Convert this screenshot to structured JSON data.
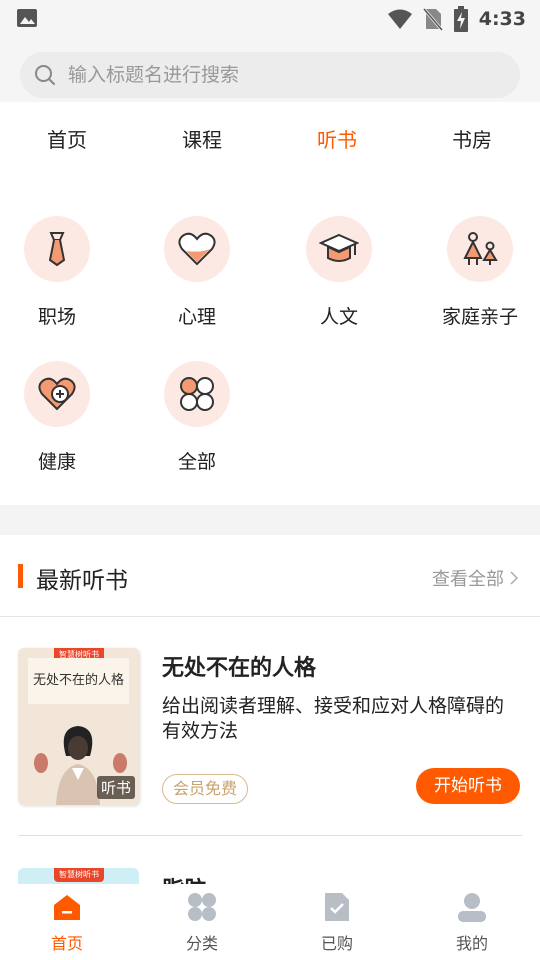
{
  "status_bar": {
    "time": "4:33"
  },
  "search": {
    "placeholder": "输入标题名进行搜索"
  },
  "tabs": [
    {
      "label": "首页",
      "active": false
    },
    {
      "label": "课程",
      "active": false
    },
    {
      "label": "听书",
      "active": true
    },
    {
      "label": "书房",
      "active": false
    }
  ],
  "categories": [
    {
      "label": "职场",
      "icon": "tie-icon"
    },
    {
      "label": "心理",
      "icon": "heart-icon"
    },
    {
      "label": "人文",
      "icon": "graduation-cap-icon"
    },
    {
      "label": "家庭亲子",
      "icon": "family-icon"
    },
    {
      "label": "健康",
      "icon": "health-heart-icon"
    },
    {
      "label": "全部",
      "icon": "grid-icon"
    }
  ],
  "section": {
    "title": "最新听书",
    "more": "查看全部"
  },
  "books": [
    {
      "cover_badge": "智慧树听书",
      "cover_title": "无处不在的人格",
      "cover_tag": "听书",
      "title": "无处不在的人格",
      "description": "给出阅读者理解、接受和应对人格障碍的有效方法",
      "member_tag": "会员免费",
      "action": "开始听书"
    },
    {
      "cover_badge": "智慧树听书",
      "title": "脂肪"
    }
  ],
  "bottom_nav": [
    {
      "label": "首页",
      "icon": "home-icon",
      "active": true
    },
    {
      "label": "分类",
      "icon": "category-icon",
      "active": false
    },
    {
      "label": "已购",
      "icon": "purchased-icon",
      "active": false
    },
    {
      "label": "我的",
      "icon": "profile-icon",
      "active": false
    }
  ],
  "colors": {
    "accent": "#ff5a00",
    "icon_bg": "#fde9e3",
    "member": "#c9a36f"
  }
}
